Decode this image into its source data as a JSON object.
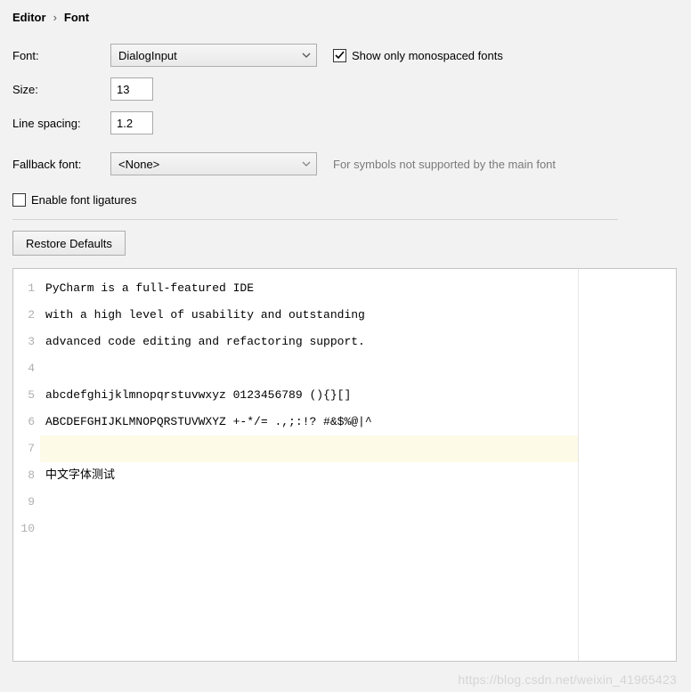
{
  "breadcrumb": {
    "parent": "Editor",
    "current": "Font"
  },
  "labels": {
    "font": "Font:",
    "size": "Size:",
    "line_spacing": "Line spacing:",
    "fallback": "Fallback font:",
    "show_mono": "Show only monospaced fonts",
    "fallback_hint": "For symbols not supported by the main font",
    "ligatures": "Enable font ligatures",
    "restore": "Restore Defaults"
  },
  "values": {
    "font": "DialogInput",
    "size": "13",
    "line_spacing": "1.2",
    "fallback": "<None>",
    "show_mono_checked": true,
    "ligatures_checked": false
  },
  "preview_lines": [
    "PyCharm is a full-featured IDE",
    "with a high level of usability and outstanding",
    "advanced code editing and refactoring support.",
    "",
    "abcdefghijklmnopqrstuvwxyz 0123456789 (){}[]",
    "ABCDEFGHIJKLMNOPQRSTUVWXYZ +-*/= .,;:!? #&$%@|^",
    "",
    "中文字体测试",
    "",
    ""
  ],
  "highlight_line_index": 6,
  "watermark": "https://blog.csdn.net/weixin_41965423"
}
